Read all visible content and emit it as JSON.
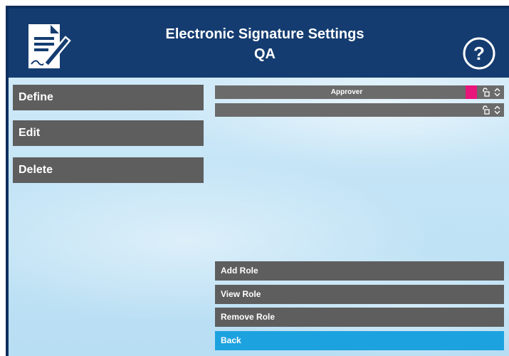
{
  "header": {
    "title": "Electronic Signature Settings",
    "subtitle": "QA",
    "doc_icon": "document-sign-icon",
    "help_icon": "help-icon"
  },
  "left_buttons": [
    {
      "label": "Define"
    },
    {
      "label": "Edit"
    },
    {
      "label": "Delete"
    }
  ],
  "roles": [
    {
      "label": "Approver",
      "color": "#e8157a",
      "lock_icon": "unlock-icon",
      "sort_icon": "sort-arrows-icon"
    },
    {
      "label": "",
      "color": null,
      "lock_icon": "unlock-icon",
      "sort_icon": "sort-arrows-icon"
    }
  ],
  "actions": [
    {
      "label": "Add Role"
    },
    {
      "label": "View Role"
    },
    {
      "label": "Remove Role"
    },
    {
      "label": "Back"
    }
  ],
  "colors": {
    "header_bg": "#143c70",
    "button_bg": "#5e5e5e",
    "primary_bg": "#1da2e0",
    "role_marker": "#e8157a"
  }
}
